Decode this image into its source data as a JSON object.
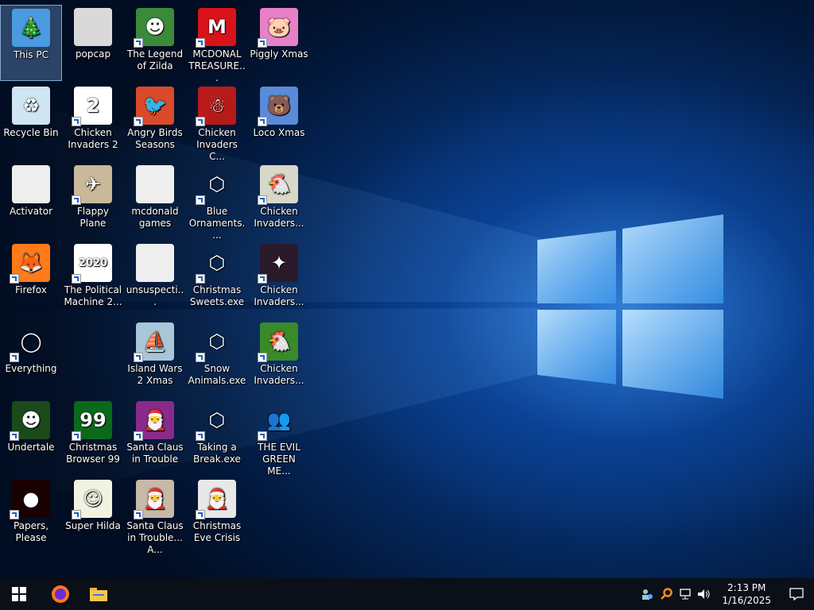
{
  "desktop": {
    "icons": [
      {
        "label": "This PC",
        "glyph": "🎄",
        "bg": "#4a9be0",
        "selected": true,
        "shortcut": false
      },
      {
        "label": "Recycle Bin",
        "glyph": "♻",
        "bg": "#cfe6f2",
        "shortcut": false
      },
      {
        "label": "Activator",
        "glyph": "",
        "bg": "#eeeeee",
        "shortcut": false
      },
      {
        "label": "Firefox",
        "glyph": "🦊",
        "bg": "#ff7a1a",
        "shortcut": true
      },
      {
        "label": "Everything",
        "glyph": "◯",
        "bg": "transparent",
        "shortcut": true
      },
      {
        "label": "Undertale",
        "glyph": "☻",
        "bg": "#1a4a1a",
        "shortcut": true
      },
      {
        "label": "Papers, Please",
        "glyph": "●",
        "bg": "#1a0000",
        "shortcut": true
      },
      {
        "label": "popcap",
        "glyph": "",
        "bg": "#d9d9d9",
        "shortcut": false
      },
      {
        "label": "Chicken Invaders 2",
        "glyph": "2",
        "bg": "#ffffff",
        "shortcut": true
      },
      {
        "label": "Flappy Plane",
        "glyph": "✈",
        "bg": "#c9b89a",
        "shortcut": true
      },
      {
        "label": "The Political Machine 2...",
        "glyph": "2020",
        "bg": "#ffffff",
        "shortcut": true
      },
      {
        "label": "Christmas Browser 99",
        "glyph": "99",
        "bg": "#0a6a1a",
        "shortcut": true
      },
      {
        "label": "Super Hilda",
        "glyph": "☺",
        "bg": "#f2f2e0",
        "shortcut": true
      },
      {
        "label": "The Legend of Zilda",
        "glyph": "☻",
        "bg": "#3a8a3a",
        "shortcut": true
      },
      {
        "label": "Angry Birds Seasons",
        "glyph": "🐦",
        "bg": "#d94a2a",
        "shortcut": true
      },
      {
        "label": "mcdonald games",
        "glyph": "",
        "bg": "#eeeeee",
        "shortcut": false
      },
      {
        "label": "unsuspecti...",
        "glyph": "",
        "bg": "#eeeeee",
        "shortcut": false
      },
      {
        "label": "Island Wars 2 Xmas",
        "glyph": "⛵",
        "bg": "#a8c6d8",
        "shortcut": true
      },
      {
        "label": "Santa Claus in Trouble",
        "glyph": "🎅",
        "bg": "#8a2a8a",
        "shortcut": true
      },
      {
        "label": "Santa Claus in Trouble... A...",
        "glyph": "🎅",
        "bg": "#c8b8a8",
        "shortcut": true
      },
      {
        "label": "MCDONAL TREASURE...",
        "glyph": "M",
        "bg": "#d8141a",
        "shortcut": true
      },
      {
        "label": "Chicken Invaders C...",
        "glyph": "☃",
        "bg": "#b81a1a",
        "shortcut": true
      },
      {
        "label": "Blue Ornaments....",
        "glyph": "⬡",
        "bg": "transparent",
        "shortcut": true
      },
      {
        "label": "Christmas Sweets.exe",
        "glyph": "⬡",
        "bg": "transparent",
        "shortcut": true
      },
      {
        "label": "Snow Animals.exe",
        "glyph": "⬡",
        "bg": "transparent",
        "shortcut": true
      },
      {
        "label": "Taking a Break.exe",
        "glyph": "⬡",
        "bg": "transparent",
        "shortcut": true
      },
      {
        "label": "Christmas Eve Crisis",
        "glyph": "🎅",
        "bg": "#e8e8e8",
        "shortcut": true
      },
      {
        "label": "Piggly Xmas",
        "glyph": "🐷",
        "bg": "#e880c8",
        "shortcut": true
      },
      {
        "label": "Loco Xmas",
        "glyph": "🐻",
        "bg": "#5a8ad8",
        "shortcut": true
      },
      {
        "label": "Chicken Invaders...",
        "glyph": "🐔",
        "bg": "#d8d8c8",
        "shortcut": true
      },
      {
        "label": "Chicken Invaders...",
        "glyph": "✦",
        "bg": "#2a1a2a",
        "shortcut": true
      },
      {
        "label": "Chicken Invaders...",
        "glyph": "🐔",
        "bg": "#3a8a2a",
        "shortcut": true
      },
      {
        "label": "THE EVIL GREEN ME...",
        "glyph": "👥",
        "bg": "transparent",
        "shortcut": true
      }
    ]
  },
  "taskbar": {
    "start_glyph": "⊞",
    "pinned": [
      {
        "name": "firefox-taskbar-icon",
        "glyph": "🦊"
      },
      {
        "name": "file-explorer-taskbar-icon",
        "glyph": "📁"
      }
    ],
    "tray": [
      "🧍",
      "🔍",
      "🖧",
      "🔊"
    ],
    "time": "2:13 PM",
    "date": "1/16/2025",
    "notifications_glyph": "🗨"
  },
  "colors": {
    "taskbar": "#0b0f17",
    "selection": "#78aae6",
    "wallpaper_glow": "#50aaff"
  }
}
